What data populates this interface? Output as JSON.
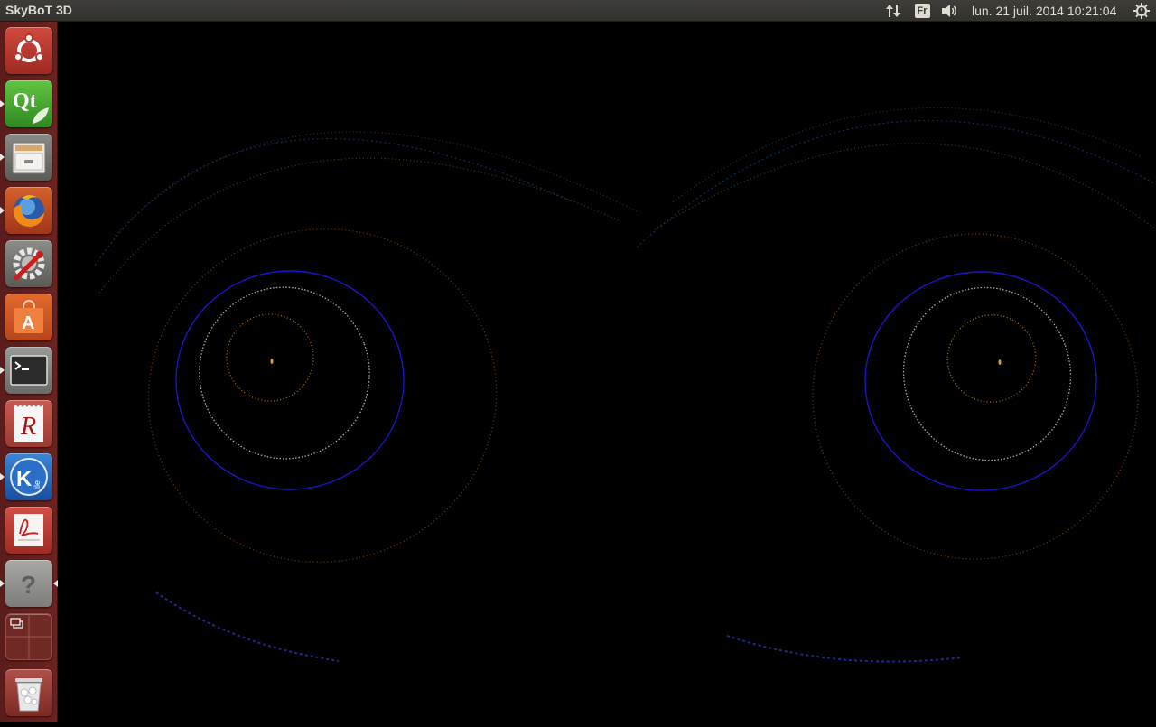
{
  "window_title": "SkyBoT 3D",
  "panel": {
    "keyboard_layout": "Fr",
    "clock": "lun. 21 juil. 2014 10:21:04",
    "icons": {
      "network": "network-transfer-icon",
      "sound": "speaker-icon",
      "session": "gear-power-icon"
    }
  },
  "launcher": {
    "items": [
      {
        "name": "dash-home",
        "icon": "ubuntu-logo-icon"
      },
      {
        "name": "qt-creator",
        "icon": "qt-icon",
        "label": "Qt"
      },
      {
        "name": "file-manager",
        "icon": "file-cabinet-icon"
      },
      {
        "name": "firefox",
        "icon": "firefox-icon"
      },
      {
        "name": "system-settings",
        "icon": "settings-wrench-icon"
      },
      {
        "name": "software-center",
        "icon": "shopping-bag-icon",
        "label": "A"
      },
      {
        "name": "terminal",
        "icon": "terminal-icon",
        "label": ">_"
      },
      {
        "name": "r-studio",
        "icon": "notepad-r-icon",
        "label": "R"
      },
      {
        "name": "kile",
        "icon": "kile-icon",
        "label": "K"
      },
      {
        "name": "pdf-reader",
        "icon": "pdf-icon"
      },
      {
        "name": "help",
        "icon": "help-question-icon",
        "label": "?"
      },
      {
        "name": "workspace-switcher",
        "icon": "workspaces-icon"
      },
      {
        "name": "trash",
        "icon": "trash-icon"
      }
    ]
  },
  "colors": {
    "launcher_bg": "#6b2321",
    "panel_bg": "#3a3935",
    "panel_text": "#dfdbd2",
    "viewport_bg": "#000000",
    "orbit_blue": "#1a14c8",
    "orbit_white": "#b8b8b8",
    "orbit_orange": "#a86418",
    "sun": "#e0a020"
  }
}
